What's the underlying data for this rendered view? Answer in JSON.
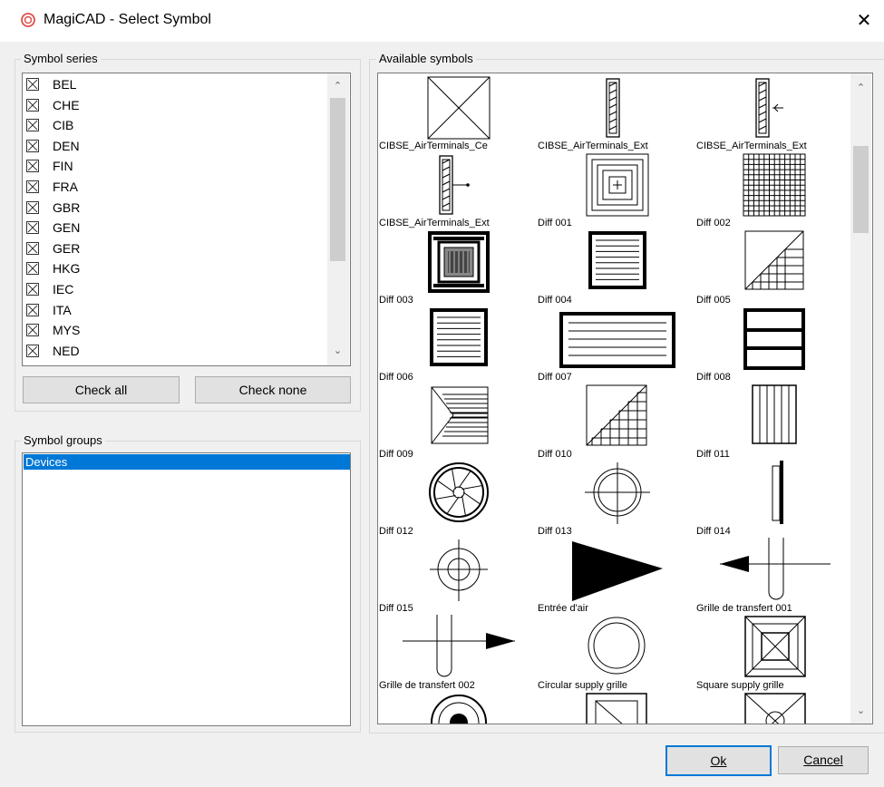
{
  "window": {
    "title": "MagiCAD - Select Symbol",
    "close_glyph": "✕",
    "app_icon": "magicad-logo-icon",
    "accent": "#0078d7"
  },
  "symbol_series": {
    "label": "Symbol series",
    "items": [
      "BEL",
      "CHE",
      "CIB",
      "DEN",
      "FIN",
      "FRA",
      "GBR",
      "GEN",
      "GER",
      "HKG",
      "IEC",
      "ITA",
      "MYS",
      "NED"
    ],
    "checked": true
  },
  "buttons": {
    "check_all": "Check all",
    "check_none": "Check none",
    "ok": "Ok",
    "cancel": "Cancel"
  },
  "symbol_groups": {
    "label": "Symbol groups",
    "items": [
      "Devices"
    ],
    "selected": "Devices"
  },
  "available_symbols": {
    "label": "Available symbols",
    "items": [
      {
        "label": "CIBSE_AirTerminals_Ce",
        "icon": "square-x-icon"
      },
      {
        "label": "CIBSE_AirTerminals_Ext",
        "icon": "slot-diffuser-icon"
      },
      {
        "label": "CIBSE_AirTerminals_Ext",
        "icon": "slot-diffuser-arrow-icon"
      },
      {
        "label": "CIBSE_AirTerminals_Ext",
        "icon": "slot-diffuser-flow-icon"
      },
      {
        "label": "Diff 001",
        "icon": "concentric-squares-icon"
      },
      {
        "label": "Diff 002",
        "icon": "grid-icon"
      },
      {
        "label": "Diff 003",
        "icon": "mesh-diffuser-icon"
      },
      {
        "label": "Diff 004",
        "icon": "lined-square-icon"
      },
      {
        "label": "Diff 005",
        "icon": "diagonal-vanes-icon"
      },
      {
        "label": "Diff 006",
        "icon": "lined-square-icon"
      },
      {
        "label": "Diff 007",
        "icon": "wide-lined-icon"
      },
      {
        "label": "Diff 008",
        "icon": "three-band-icon"
      },
      {
        "label": "Diff 009",
        "icon": "arrow-vanes-icon"
      },
      {
        "label": "Diff 010",
        "icon": "corner-vanes-icon"
      },
      {
        "label": "Diff 011",
        "icon": "vertical-lines-icon"
      },
      {
        "label": "Diff 012",
        "icon": "swirl-diffuser-icon"
      },
      {
        "label": "Diff 013",
        "icon": "circle-crosshair-icon"
      },
      {
        "label": "Diff 014",
        "icon": "wall-grille-icon"
      },
      {
        "label": "Diff 015",
        "icon": "double-circle-crosshair-icon"
      },
      {
        "label": "Entrée d'air",
        "icon": "triangle-icon"
      },
      {
        "label": "Grille de transfert 001",
        "icon": "transfer-left-icon"
      },
      {
        "label": "Grille de transfert 002",
        "icon": "transfer-right-icon"
      },
      {
        "label": "Circular supply grille",
        "icon": "double-circle-icon"
      },
      {
        "label": "Square supply grille",
        "icon": "framed-x-icon"
      },
      {
        "label": "",
        "icon": "partial-circle-icon"
      },
      {
        "label": "",
        "icon": "partial-square-icon"
      },
      {
        "label": "",
        "icon": "partial-x-icon"
      }
    ]
  }
}
